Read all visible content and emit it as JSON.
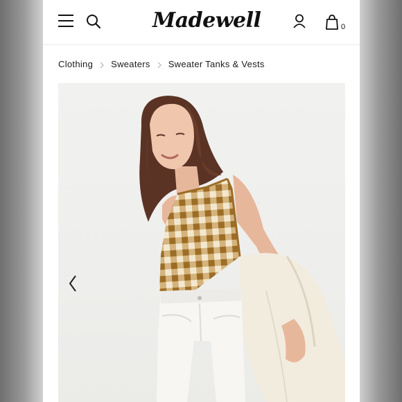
{
  "header": {
    "logo_text": "Madewell",
    "bag_count": "0",
    "icons": [
      "menu-icon",
      "search-icon",
      "account-icon",
      "shopping-bag-icon"
    ]
  },
  "breadcrumb": {
    "items": [
      "Clothing",
      "Sweaters",
      "Sweater Tanks & Vests"
    ]
  },
  "gallery": {
    "nav_icons": [
      "chevron-left-icon",
      "chevron-right-icon"
    ]
  },
  "colors": {
    "gingham_mustard": "#b98a3e",
    "gingham_cream": "#f3e8cf",
    "jacket": "#f2ecdf",
    "shorts": "#f7f6f3",
    "text": "#1a1a1a"
  }
}
